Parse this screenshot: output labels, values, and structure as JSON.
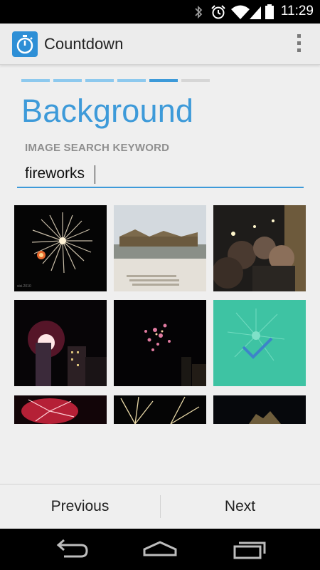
{
  "status_bar": {
    "time": "11:29",
    "icons": [
      "bluetooth-icon",
      "alarm-icon",
      "wifi-icon",
      "signal-icon",
      "battery-icon"
    ]
  },
  "action_bar": {
    "app_title": "Countdown",
    "app_icon": "stopwatch-icon",
    "menu_icon": "overflow-menu-icon"
  },
  "wizard": {
    "total_steps": 6,
    "current_step": 5,
    "title": "Background",
    "keyword_label": "IMAGE SEARCH KEYWORD",
    "keyword_value": "fireworks"
  },
  "results": [
    {
      "name": "fireworks-photo-1",
      "selected": false
    },
    {
      "name": "beach-pavilion-photo",
      "selected": false
    },
    {
      "name": "crowd-photo",
      "selected": false
    },
    {
      "name": "fireworks-city-photo",
      "selected": false
    },
    {
      "name": "fireworks-night-photo",
      "selected": false
    },
    {
      "name": "fireworks-photo-selected",
      "selected": true
    },
    {
      "name": "fireworks-red-photo",
      "selected": false
    },
    {
      "name": "fireworks-gold-photo",
      "selected": false
    },
    {
      "name": "night-skyline-photo",
      "selected": false
    }
  ],
  "buttons": {
    "previous": "Previous",
    "next": "Next"
  },
  "nav_bar": {
    "back_icon": "back-icon",
    "home_icon": "home-icon",
    "recents_icon": "recents-icon"
  },
  "colors": {
    "accent": "#3d9ad9",
    "step_done": "#8dc9ee",
    "step_current": "#3d9ad9",
    "step_pending": "#d6d6d6",
    "selection_overlay": "#3ec3a3"
  }
}
